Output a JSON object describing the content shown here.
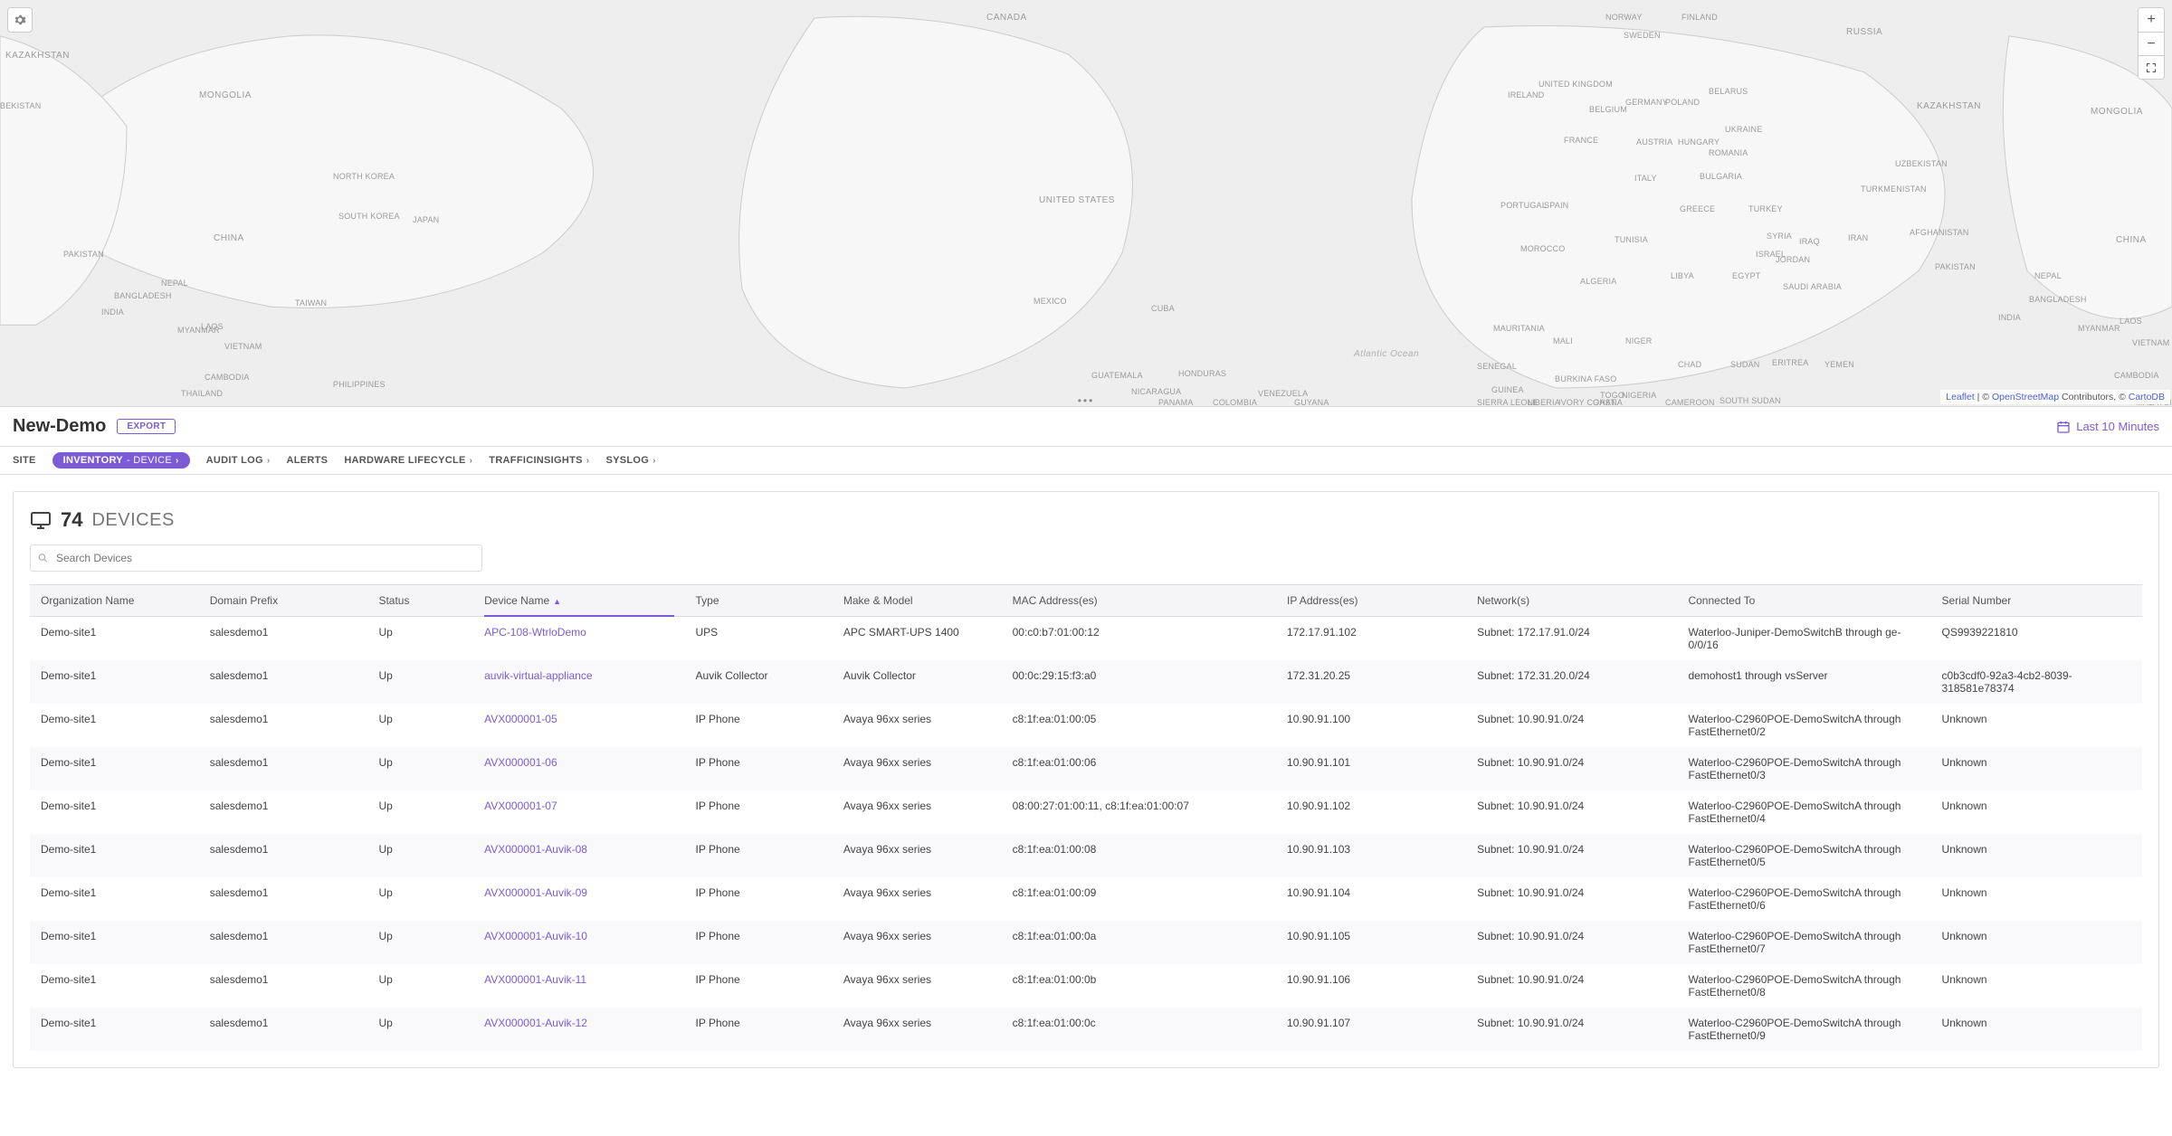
{
  "map": {
    "attribution_leaflet": "Leaflet",
    "attribution_mid1": " | © ",
    "attribution_osm": "OpenStreetMap",
    "attribution_mid2": " Contributors, © ",
    "attribution_carto": "CartoDB",
    "labels": {
      "canada": "CANADA",
      "united_states": "UNITED STATES",
      "mexico": "MEXICO",
      "cuba": "CUBA",
      "guatemala": "GUATEMALA",
      "honduras": "HONDURAS",
      "nicaragua": "NICARAGUA",
      "panama": "PANAMA",
      "colombia": "COLOMBIA",
      "venezuela": "VENEZUELA",
      "guyana": "GUYANA",
      "atlantic_ocean": "Atlantic Ocean",
      "norway": "NORWAY",
      "sweden": "SWEDEN",
      "finland": "FINLAND",
      "russia": "RUSSIA",
      "united_kingdom": "UNITED KINGDOM",
      "ireland": "IRELAND",
      "belgium": "BELGIUM",
      "germany": "GERMANY",
      "poland": "POLAND",
      "belarus": "BELARUS",
      "ukraine": "UKRAINE",
      "france": "FRANCE",
      "austria": "AUSTRIA",
      "hungary": "HUNGARY",
      "romania": "ROMANIA",
      "italy": "ITALY",
      "spain": "SPAIN",
      "portugal": "PORTUGAL",
      "bulgaria": "BULGARIA",
      "greece": "GREECE",
      "turkey": "TURKEY",
      "syria": "SYRIA",
      "iraq": "IRAQ",
      "iran": "IRAN",
      "israel": "ISRAEL",
      "jordan": "JORDAN",
      "saudi_arabia": "SAUDI ARABIA",
      "egypt": "EGYPT",
      "libya": "LIBYA",
      "tunisia": "TUNISIA",
      "algeria": "ALGERIA",
      "morocco": "MOROCCO",
      "mauritania": "MAURITANIA",
      "mali": "MALI",
      "niger": "NIGER",
      "chad": "CHAD",
      "sudan": "SUDAN",
      "south_sudan": "SOUTH SUDAN",
      "eritrea": "ERITREA",
      "yemen": "YEMEN",
      "senegal": "SENEGAL",
      "guinea": "GUINEA",
      "sierra_leone": "SIERRA LEONE",
      "liberia": "LIBERIA",
      "ivory_coast": "IVORY COAST",
      "ghana": "GHANA",
      "burkina_faso": "BURKINA FASO",
      "togo": "TOGO",
      "nigeria": "NIGERIA",
      "cameroon": "CAMEROON",
      "kazakhstan": "KAZAKHSTAN",
      "uzbekistan": "UZBEKISTAN",
      "turkmenistan": "TURKMENISTAN",
      "afghanistan": "AFGHANISTAN",
      "pakistan": "PAKISTAN",
      "india": "INDIA",
      "nepal": "NEPAL",
      "bangladesh": "BANGLADESH",
      "myanmar": "MYANMAR",
      "china": "CHINA",
      "mongolia": "MONGOLIA",
      "north_korea": "NORTH KOREA",
      "south_korea": "SOUTH KOREA",
      "japan": "JAPAN",
      "taiwan": "TAIWAN",
      "laos": "LAOS",
      "vietnam": "VIETNAM",
      "cambodia": "CAMBODIA",
      "thailand": "THAILAND",
      "philippines": "PHILIPPINES",
      "malaysia": "MALAYSIA",
      "kazakhstan_w": "KAZAKHSTAN",
      "uzbekistan_w": "BEKISTAN",
      "russia_e": "RUSSIA",
      "mongolia_w": "MONGOLIA",
      "china_w": "CHINA",
      "pakistan_w": "PAKISTAN",
      "india_w": "INDIA",
      "nepal_w": "NEPAL",
      "bangladesh_w": "BANGLADESH",
      "myanmar_w": "MYANMAR",
      "laos_w": "LAOS",
      "vietnam_w": "VIETNAM",
      "cambodia_w": "CAMBODIA"
    }
  },
  "header": {
    "title": "New-Demo",
    "export_label": "EXPORT",
    "time_range": "Last 10 Minutes"
  },
  "tabs": {
    "site": "SITE",
    "inventory_label": "INVENTORY",
    "inventory_sub": " - DEVICE",
    "auditlog": "AUDIT LOG",
    "alerts": "ALERTS",
    "hw_lifecycle": "HARDWARE LIFECYCLE",
    "traffic": "TRAFFICINSIGHTS",
    "syslog": "SYSLOG"
  },
  "panel": {
    "count": "74",
    "word": "DEVICES",
    "search_placeholder": "Search Devices"
  },
  "columns": [
    "Organization Name",
    "Domain Prefix",
    "Status",
    "Device Name",
    "Type",
    "Make & Model",
    "MAC Address(es)",
    "IP Address(es)",
    "Network(s)",
    "Connected To",
    "Serial Number"
  ],
  "rows": [
    {
      "org": "Demo-site1",
      "domain": "salesdemo1",
      "status": "Up",
      "device": "APC-108-WtrloDemo",
      "type": "UPS",
      "make": "APC SMART-UPS 1400",
      "mac": "00:c0:b7:01:00:12",
      "ip": "172.17.91.102",
      "net": "Subnet: 172.17.91.0/24",
      "conn": "Waterloo-Juniper-DemoSwitchB through ge-0/0/16",
      "serial": "QS9939221810"
    },
    {
      "org": "Demo-site1",
      "domain": "salesdemo1",
      "status": "Up",
      "device": "auvik-virtual-appliance",
      "type": "Auvik Collector",
      "make": "Auvik Collector",
      "mac": "00:0c:29:15:f3:a0",
      "ip": "172.31.20.25",
      "net": "Subnet: 172.31.20.0/24",
      "conn": "demohost1 through vsServer",
      "serial": "c0b3cdf0-92a3-4cb2-8039-318581e78374"
    },
    {
      "org": "Demo-site1",
      "domain": "salesdemo1",
      "status": "Up",
      "device": "AVX000001-05",
      "type": "IP Phone",
      "make": "Avaya 96xx series",
      "mac": "c8:1f:ea:01:00:05",
      "ip": "10.90.91.100",
      "net": "Subnet: 10.90.91.0/24",
      "conn": "Waterloo-C2960POE-DemoSwitchA through FastEthernet0/2",
      "serial": "Unknown"
    },
    {
      "org": "Demo-site1",
      "domain": "salesdemo1",
      "status": "Up",
      "device": "AVX000001-06",
      "type": "IP Phone",
      "make": "Avaya 96xx series",
      "mac": "c8:1f:ea:01:00:06",
      "ip": "10.90.91.101",
      "net": "Subnet: 10.90.91.0/24",
      "conn": "Waterloo-C2960POE-DemoSwitchA through FastEthernet0/3",
      "serial": "Unknown"
    },
    {
      "org": "Demo-site1",
      "domain": "salesdemo1",
      "status": "Up",
      "device": "AVX000001-07",
      "type": "IP Phone",
      "make": "Avaya 96xx series",
      "mac": "08:00:27:01:00:11, c8:1f:ea:01:00:07",
      "ip": "10.90.91.102",
      "net": "Subnet: 10.90.91.0/24",
      "conn": "Waterloo-C2960POE-DemoSwitchA through FastEthernet0/4",
      "serial": "Unknown"
    },
    {
      "org": "Demo-site1",
      "domain": "salesdemo1",
      "status": "Up",
      "device": "AVX000001-Auvik-08",
      "type": "IP Phone",
      "make": "Avaya 96xx series",
      "mac": "c8:1f:ea:01:00:08",
      "ip": "10.90.91.103",
      "net": "Subnet: 10.90.91.0/24",
      "conn": "Waterloo-C2960POE-DemoSwitchA through FastEthernet0/5",
      "serial": "Unknown"
    },
    {
      "org": "Demo-site1",
      "domain": "salesdemo1",
      "status": "Up",
      "device": "AVX000001-Auvik-09",
      "type": "IP Phone",
      "make": "Avaya 96xx series",
      "mac": "c8:1f:ea:01:00:09",
      "ip": "10.90.91.104",
      "net": "Subnet: 10.90.91.0/24",
      "conn": "Waterloo-C2960POE-DemoSwitchA through FastEthernet0/6",
      "serial": "Unknown"
    },
    {
      "org": "Demo-site1",
      "domain": "salesdemo1",
      "status": "Up",
      "device": "AVX000001-Auvik-10",
      "type": "IP Phone",
      "make": "Avaya 96xx series",
      "mac": "c8:1f:ea:01:00:0a",
      "ip": "10.90.91.105",
      "net": "Subnet: 10.90.91.0/24",
      "conn": "Waterloo-C2960POE-DemoSwitchA through FastEthernet0/7",
      "serial": "Unknown"
    },
    {
      "org": "Demo-site1",
      "domain": "salesdemo1",
      "status": "Up",
      "device": "AVX000001-Auvik-11",
      "type": "IP Phone",
      "make": "Avaya 96xx series",
      "mac": "c8:1f:ea:01:00:0b",
      "ip": "10.90.91.106",
      "net": "Subnet: 10.90.91.0/24",
      "conn": "Waterloo-C2960POE-DemoSwitchA through FastEthernet0/8",
      "serial": "Unknown"
    },
    {
      "org": "Demo-site1",
      "domain": "salesdemo1",
      "status": "Up",
      "device": "AVX000001-Auvik-12",
      "type": "IP Phone",
      "make": "Avaya 96xx series",
      "mac": "c8:1f:ea:01:00:0c",
      "ip": "10.90.91.107",
      "net": "Subnet: 10.90.91.0/24",
      "conn": "Waterloo-C2960POE-DemoSwitchA through FastEthernet0/9",
      "serial": "Unknown"
    }
  ]
}
